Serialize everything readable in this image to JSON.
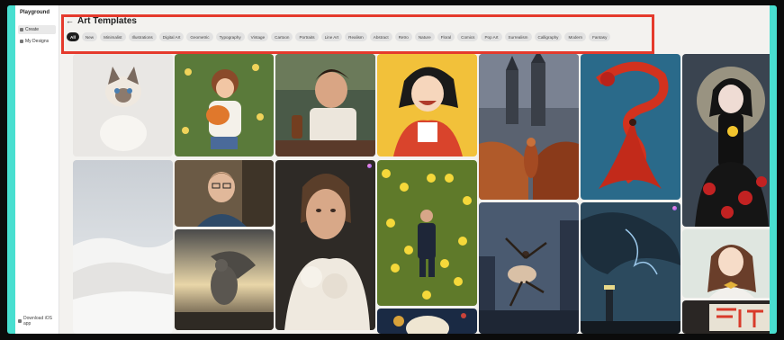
{
  "sidebar": {
    "brand": "Playground",
    "items": [
      {
        "label": "Create",
        "active": true
      },
      {
        "label": "My Designs",
        "active": false
      }
    ],
    "download": "Download iOS app"
  },
  "header": {
    "back_icon": "←",
    "title": "Art Templates"
  },
  "filters": [
    "All",
    "New",
    "Minimalist",
    "Illustrations",
    "Digital Art",
    "Geometric",
    "Typography",
    "Vintage",
    "Cartoon",
    "Portraits",
    "Line Art",
    "Realism",
    "Abstract",
    "Retro",
    "Nature",
    "Floral",
    "Comics",
    "Pop Art",
    "Surrealism",
    "Calligraphy",
    "Modern",
    "Fantasy"
  ],
  "active_filter": "All",
  "gallery": [
    {
      "subject": "siamese kitten"
    },
    {
      "subject": "girl hugging fox in flowers"
    },
    {
      "subject": "man at diner counter"
    },
    {
      "subject": "laughing anime girl"
    },
    {
      "subject": "woman walking to castle"
    },
    {
      "subject": "red dragon and woman in water"
    },
    {
      "subject": "gothic woman with roses"
    },
    {
      "subject": "white sand dunes"
    },
    {
      "subject": "young man with glasses"
    },
    {
      "subject": "woman with white ruffled dress"
    },
    {
      "subject": "man in daffodil field"
    },
    {
      "subject": "ballet dancer in city"
    },
    {
      "subject": "lighthouse under storm"
    },
    {
      "subject": "anime girl with bow"
    },
    {
      "subject": "weeping angel statue"
    },
    {
      "subject": "retro astronaut poster"
    },
    {
      "subject": "neon sign street"
    }
  ],
  "colors": {
    "accent_frame": "#48dfd0",
    "highlight_box": "#e53a2c",
    "active_chip": "#1d1d1d"
  }
}
